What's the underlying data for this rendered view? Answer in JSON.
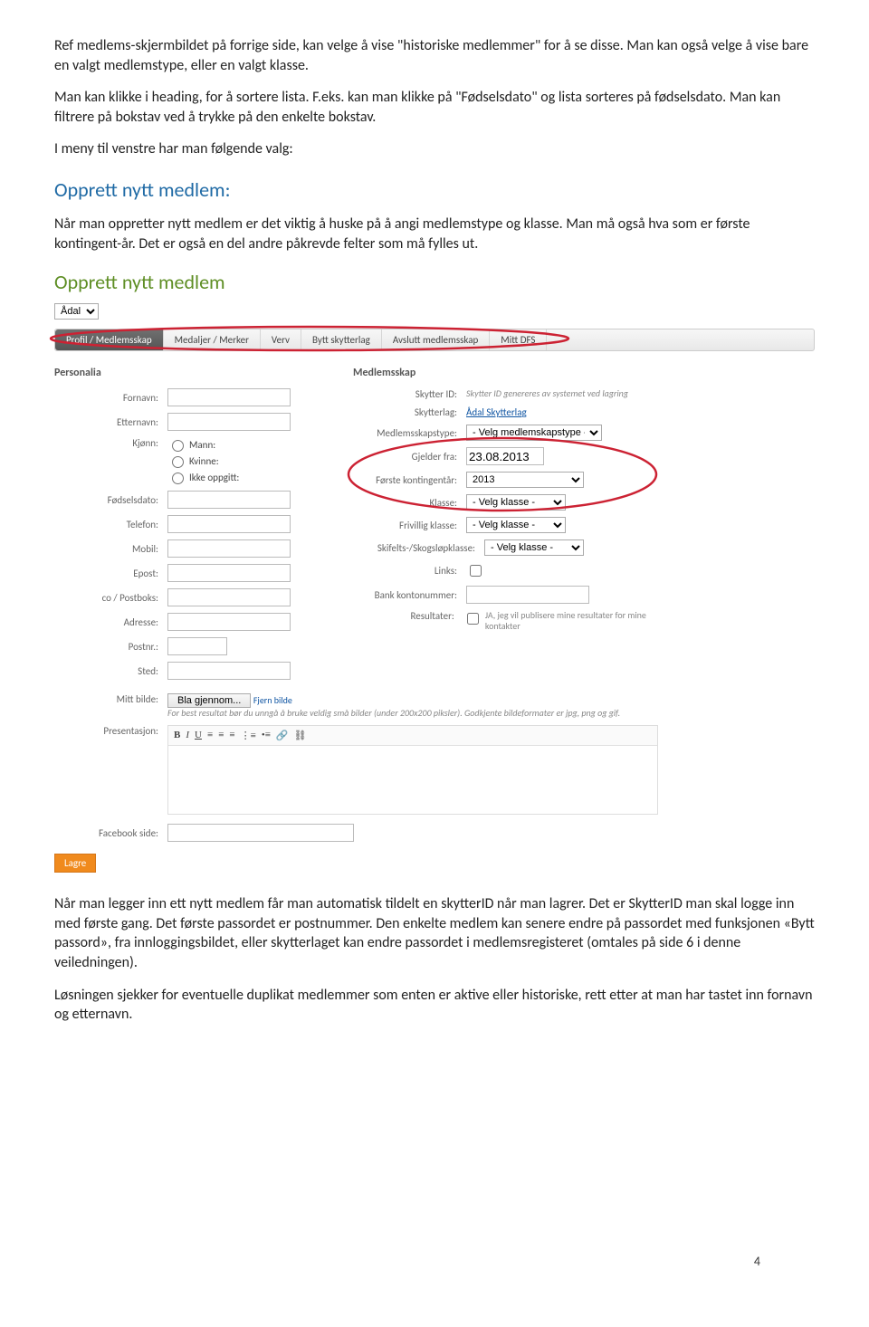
{
  "intro": {
    "p1": "Ref medlems-skjermbildet på forrige side, kan velge å vise \"historiske medlemmer\" for å se disse. Man kan også velge å vise bare en valgt medlemstype, eller en valgt klasse.",
    "p2": "Man kan klikke i heading, for å sortere lista. F.eks. kan man klikke på \"Fødselsdato\" og lista sorteres på fødselsdato. Man kan filtrere på bokstav ved å trykke på den enkelte bokstav.",
    "p3": "I meny til venstre har man følgende valg:"
  },
  "section_title": "Opprett nytt medlem:",
  "section_desc": "Når man oppretter nytt medlem er det viktig å huske på å angi medlemstype og klasse. Man må også hva som er første kontingent-år. Det er også en del andre påkrevde felter som må fylles ut.",
  "ui": {
    "title": "Opprett nytt medlem",
    "org_select": "Ådal",
    "tabs": [
      "Profil / Medlemsskap",
      "Medaljer / Merker",
      "Verv",
      "Bytt skytterlag",
      "Avslutt medlemsskap",
      "Mitt DFS"
    ],
    "left": {
      "heading": "Personalia",
      "fields": {
        "fornavn": "Fornavn:",
        "etternavn": "Etternavn:",
        "kjonn": "Kjønn:",
        "kjonn_opts": [
          "Mann:",
          "Kvinne:",
          "Ikke oppgitt:"
        ],
        "fodsel": "Fødselsdato:",
        "telefon": "Telefon:",
        "mobil": "Mobil:",
        "epost": "Epost:",
        "co": "co / Postboks:",
        "adresse": "Adresse:",
        "postnr": "Postnr.:",
        "sted": "Sted:"
      }
    },
    "right": {
      "heading": "Medlemsskap",
      "fields": {
        "skytterid": "Skytter ID:",
        "skytterid_help": "Skytter ID genereres av systemet ved lagring",
        "skytterlag": "Skytterlag:",
        "skytterlag_val": "Ådal Skytterlag",
        "mtype": "Medlemsskapstype:",
        "mtype_val": "- Velg medlemskapstype -",
        "gjelder": "Gjelder fra:",
        "gjelder_val": "23.08.2013",
        "forste": "Første kontingentår:",
        "forste_val": "2013",
        "klasse": "Klasse:",
        "klasse_val": "- Velg klasse -",
        "friv": "Frivillig klasse:",
        "friv_val": "- Velg klasse -",
        "ski": "Skifelts-/Skogsløpklasse:",
        "ski_val": "- Velg klasse -",
        "links": "Links:",
        "bank": "Bank kontonummer:",
        "resultater": "Resultater:",
        "resultater_help": "JA, jeg vil publisere mine resultater for mine kontakter"
      }
    },
    "mitt_bilde": {
      "label": "Mitt bilde:",
      "browse": "Bla gjennom...",
      "fjern": "Fjern bilde",
      "hint": "For best resultat bør du unngå å bruke veldig små bilder (under 200x200 piksler). Godkjente bildeformater er jpg, png og gif."
    },
    "presentasjon": "Presentasjon:",
    "facebook": "Facebook side:",
    "lagre": "Lagre"
  },
  "after": {
    "p1": "Når man legger inn ett nytt medlem får man automatisk tildelt en skytterID når man lagrer. Det er SkytterID man skal logge inn med første gang. Det første passordet er postnummer. Den enkelte medlem kan senere endre på passordet med funksjonen «Bytt passord», fra innloggingsbildet, eller skytterlaget kan endre passordet i medlemsregisteret (omtales på side 6 i denne veiledningen).",
    "p2": "Løsningen sjekker for eventuelle duplikat medlemmer som enten er aktive eller historiske, rett etter at man har tastet inn fornavn og etternavn."
  },
  "page_number": "4"
}
